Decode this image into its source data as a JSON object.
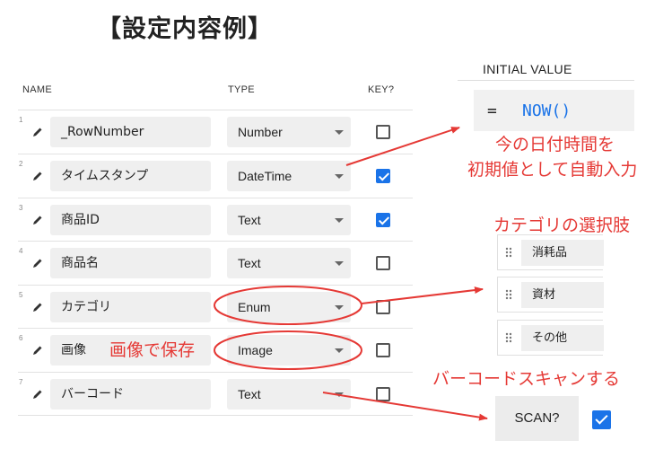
{
  "title": "【設定内容例】",
  "columns": {
    "name": "NAME",
    "type": "TYPE",
    "key": "KEY?"
  },
  "rows": [
    {
      "num": "1",
      "name": "_RowNumber",
      "type": "Number",
      "key": false
    },
    {
      "num": "2",
      "name": "タイムスタンプ",
      "type": "DateTime",
      "key": true
    },
    {
      "num": "3",
      "name": "商品ID",
      "type": "Text",
      "key": true
    },
    {
      "num": "4",
      "name": "商品名",
      "type": "Text",
      "key": false
    },
    {
      "num": "5",
      "name": "カテゴリ",
      "type": "Enum",
      "key": false
    },
    {
      "num": "6",
      "name": "画像",
      "type": "Image",
      "key": false
    },
    {
      "num": "7",
      "name": "バーコード",
      "type": "Text",
      "key": false
    }
  ],
  "initial_value": {
    "label": "INITIAL VALUE",
    "eq": "=",
    "formula": "NOW()"
  },
  "annotations": {
    "now_line1": "今の日付時間を",
    "now_line2": "初期値として自動入力",
    "enum_title": "カテゴリの選択肢",
    "image_note": "画像で保存",
    "barcode_note": "バーコードスキャンする"
  },
  "enum_values": [
    "消耗品",
    "資材",
    "その他"
  ],
  "scan": {
    "label": "SCAN?",
    "checked": true
  },
  "colors": {
    "accent": "#1a73e8",
    "annotation": "#e53935"
  }
}
